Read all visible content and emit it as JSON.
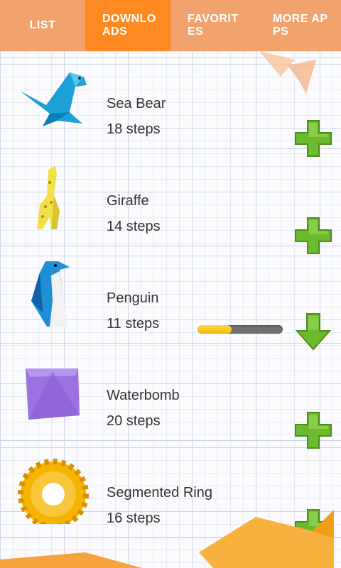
{
  "tabs": [
    {
      "label": "LIST",
      "active": false
    },
    {
      "label": "DOWNLOADS",
      "active": true
    },
    {
      "label": "FAVORITES",
      "active": false
    },
    {
      "label": "MORE APPS",
      "active": false
    }
  ],
  "items": [
    {
      "name": "Sea Bear",
      "steps": "18 steps",
      "action": "add-icon"
    },
    {
      "name": "Giraffe",
      "steps": "14 steps",
      "action": "add-icon"
    },
    {
      "name": "Penguin",
      "steps": "11 steps",
      "action": "download-icon",
      "download_progress": 0.4
    },
    {
      "name": "Waterbomb",
      "steps": "20 steps",
      "action": "add-icon"
    },
    {
      "name": "Segmented Ring",
      "steps": "16 steps",
      "action": "add-icon"
    }
  ],
  "colors": {
    "tab_bar": "#f1a26d",
    "tab_active": "#ff8a21",
    "add_green": "#6cbb2e",
    "progress_fill": "#f5c000",
    "progress_track": "#707070"
  }
}
